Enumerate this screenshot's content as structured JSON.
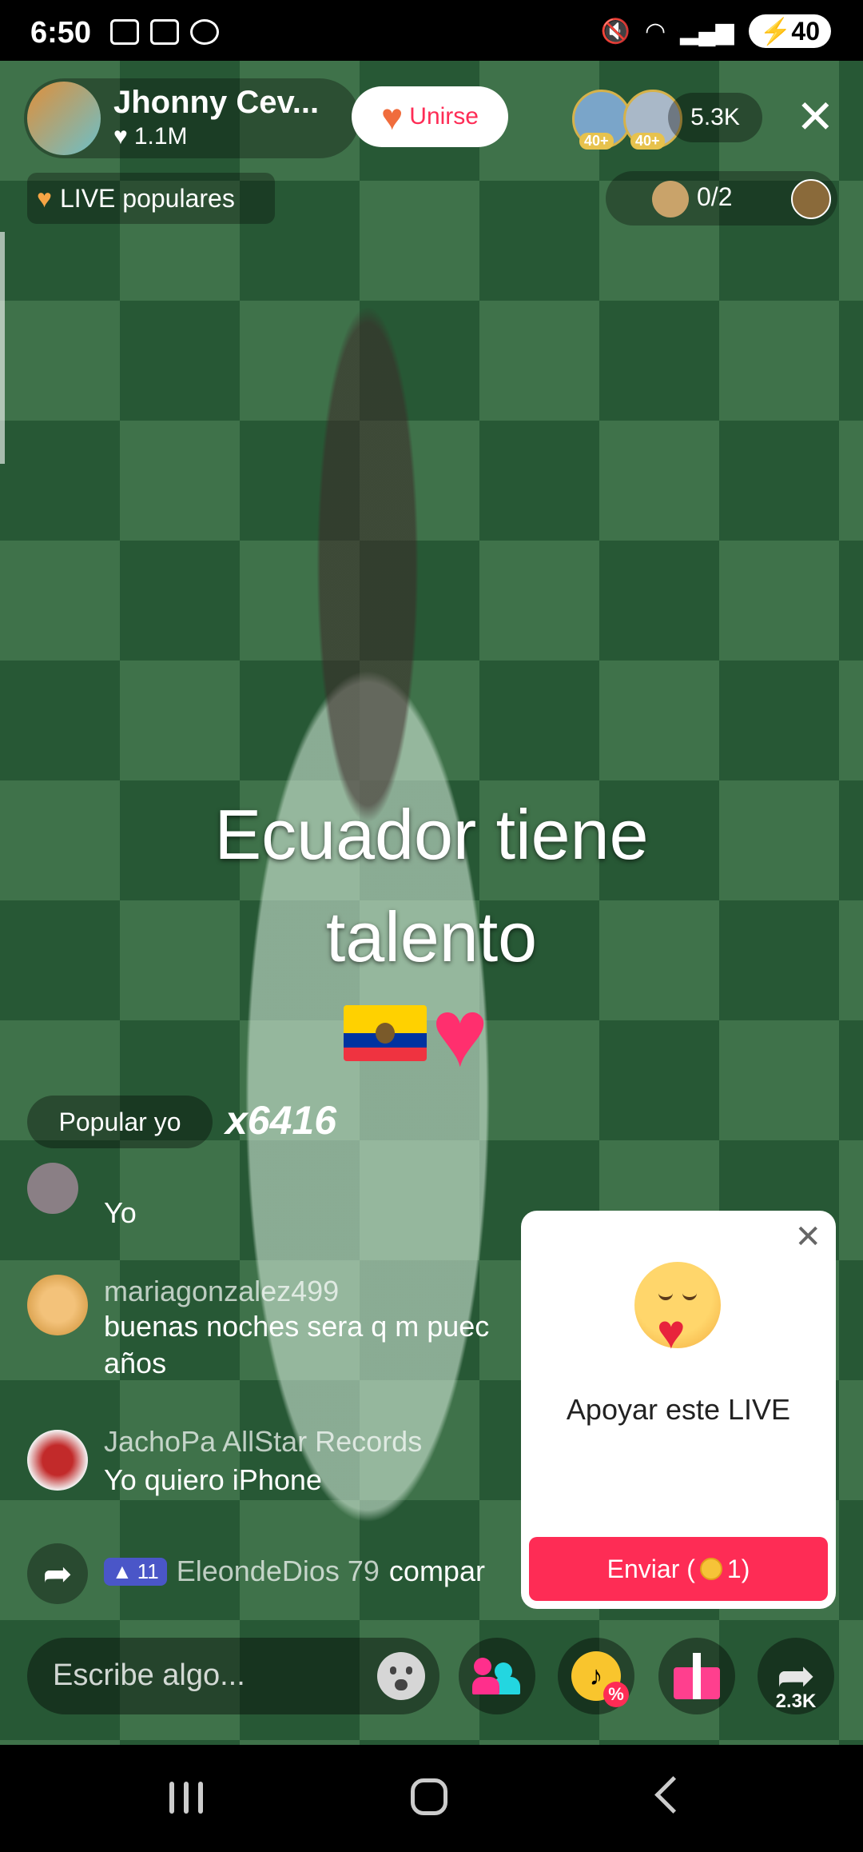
{
  "status_bar": {
    "time": "6:50",
    "icons_left": [
      "screenshot-icon",
      "screenshot-icon",
      "whatsapp-icon"
    ],
    "icons_right": [
      "mute-icon",
      "wifi-icon",
      "signal-icon"
    ],
    "battery": "40"
  },
  "host": {
    "name": "Jhonny Cev...",
    "likes": "1.1M",
    "join_label": "Unirse"
  },
  "viewers": {
    "count": "5.3K",
    "badges": [
      "40+",
      "40+"
    ]
  },
  "popular_label": "LIVE populares",
  "guests_label": "0/2",
  "caption": {
    "line1": "Ecuador tiene",
    "line2": "talento"
  },
  "combo": {
    "label": "Popular yo",
    "count": "x6416"
  },
  "chat": [
    {
      "user": "",
      "message": "Yo"
    },
    {
      "user": "mariagonzalez499",
      "message": "buenas noches sera q m puec",
      "message2": "años"
    },
    {
      "user": "JachoPa AllStar Records",
      "message": "Yo quiero iPhone"
    }
  ],
  "share_event": {
    "level": "11",
    "user": "EleondeDios 79",
    "action": "compar"
  },
  "popup": {
    "title": "Apoyar este LIVE",
    "send_label": "Enviar (",
    "send_count": "1)"
  },
  "input": {
    "placeholder": "Escribe algo..."
  },
  "share_count": "2.3K",
  "colors": {
    "accent": "#fe2c55",
    "popup_bg": "#ffffff",
    "level_badge": "#4a56c8"
  }
}
